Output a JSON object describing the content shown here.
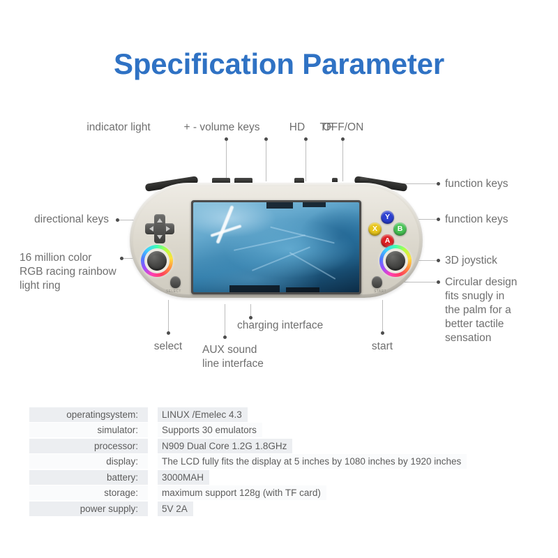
{
  "page": {
    "title": "Specification Parameter",
    "title_color": "#2f72c4",
    "background": "#ffffff"
  },
  "callouts": {
    "top": [
      {
        "id": "indicator-light",
        "label": "indicator light"
      },
      {
        "id": "volume-keys",
        "label": "+ - volume keys"
      },
      {
        "id": "hd",
        "label": "HD"
      },
      {
        "id": "tf",
        "label": "TF"
      },
      {
        "id": "off-on",
        "label": "OFF/ON"
      }
    ],
    "left": [
      {
        "id": "directional-keys",
        "label": "directional keys"
      },
      {
        "id": "rgb-light-ring",
        "label": "16 million color\nRGB racing rainbow\nlight ring"
      }
    ],
    "right": [
      {
        "id": "function-keys-top",
        "label": "function keys"
      },
      {
        "id": "function-keys-face",
        "label": "function keys"
      },
      {
        "id": "joystick-3d",
        "label": "3D joystick"
      },
      {
        "id": "circular-design",
        "label": "Circular design\nfits snugly in\nthe palm for a\nbetter tactile\nsensation"
      }
    ],
    "bottom": [
      {
        "id": "select",
        "label": "select"
      },
      {
        "id": "aux-sound",
        "label": "AUX sound\nline interface"
      },
      {
        "id": "charging-interface",
        "label": "charging interface"
      },
      {
        "id": "start",
        "label": "start"
      }
    ]
  },
  "device": {
    "name": "handheld-game-console",
    "face_buttons": [
      {
        "key": "Y",
        "color": "#2b3fd0"
      },
      {
        "key": "X",
        "color": "#e8c51a"
      },
      {
        "key": "B",
        "color": "#47c254"
      },
      {
        "key": "A",
        "color": "#dd2024"
      }
    ],
    "select_label": "SELECT",
    "start_label": "START",
    "shell_color": "#dedacf",
    "screen_image": "ice-glacier-photo"
  },
  "spec_table": {
    "rows": [
      {
        "label": "operatingsystem:",
        "value": "LINUX /Emelec 4.3"
      },
      {
        "label": "simulator:",
        "value": "Supports 30 emulators"
      },
      {
        "label": "processor:",
        "value": "N909 Dual Core 1.2G 1.8GHz"
      },
      {
        "label": "display:",
        "value": "The LCD fully fits the display at 5 inches by 1080 inches by 1920 inches"
      },
      {
        "label": "battery:",
        "value": "3000MAH"
      },
      {
        "label": "storage:",
        "value": "maximum support 128g (with  TF card)"
      },
      {
        "label": "power supply:",
        "value": "5V 2A"
      }
    ]
  }
}
